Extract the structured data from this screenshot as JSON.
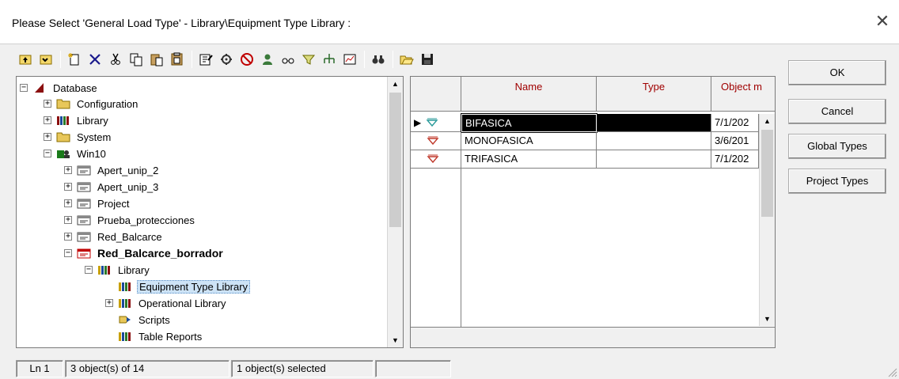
{
  "window": {
    "title": "Please Select 'General Load Type' - Library\\Equipment Type Library :",
    "close_icon": "close-icon"
  },
  "toolbar": {
    "icons": [
      "up-level-icon",
      "up-folder-icon",
      "new-object-icon",
      "delete-icon",
      "cut-icon",
      "copy-icon",
      "paste-icon",
      "paste-special-icon",
      "edit-object-icon",
      "tools-icon",
      "no-entry-icon",
      "user-icon",
      "glasses-icon",
      "filter-icon",
      "network-icon",
      "chart-icon",
      "find-icon",
      "open-folder-icon",
      "save-icon"
    ]
  },
  "tree": {
    "items": [
      {
        "label": "Database",
        "expander": "−",
        "icon": "database-icon"
      },
      {
        "label": "Configuration",
        "expander": "+",
        "icon": "folder-icon"
      },
      {
        "label": "Library",
        "expander": "+",
        "icon": "library-icon"
      },
      {
        "label": "System",
        "expander": "+",
        "icon": "folder-icon"
      },
      {
        "label": "Win10",
        "expander": "−",
        "icon": "user-folder-icon"
      },
      {
        "label": "Apert_unip_2",
        "expander": "+",
        "icon": "project-icon"
      },
      {
        "label": "Apert_unip_3",
        "expander": "+",
        "icon": "project-icon"
      },
      {
        "label": "Project",
        "expander": "+",
        "icon": "project-icon"
      },
      {
        "label": "Prueba_protecciones",
        "expander": "+",
        "icon": "project-icon"
      },
      {
        "label": "Red_Balcarce",
        "expander": "+",
        "icon": "project-icon"
      },
      {
        "label": "Red_Balcarce_borrador",
        "expander": "−",
        "icon": "active-project-icon"
      },
      {
        "label": "Library",
        "expander": "−",
        "icon": "library-icon"
      },
      {
        "label": "Equipment Type Library",
        "expander": "",
        "icon": "library-icon"
      },
      {
        "label": "Operational Library",
        "expander": "+",
        "icon": "library-icon"
      },
      {
        "label": "Scripts",
        "expander": "",
        "icon": "script-icon"
      },
      {
        "label": "Table Reports",
        "expander": "",
        "icon": "library-icon"
      }
    ]
  },
  "grid": {
    "columns": [
      "Name",
      "Type",
      "Object m"
    ],
    "rows": [
      {
        "name": "BIFASICA",
        "type": "",
        "modified": "7/1/202"
      },
      {
        "name": "MONOFASICA",
        "type": "",
        "modified": "3/6/201"
      },
      {
        "name": "TRIFASICA",
        "type": "",
        "modified": "7/1/202"
      }
    ]
  },
  "buttons": {
    "ok": "OK",
    "cancel": "Cancel",
    "global_types": "Global Types",
    "project_types": "Project Types"
  },
  "status": {
    "line": "Ln 1",
    "count": "3 object(s) of 14",
    "selected": "1 object(s) selected",
    "extra": ""
  },
  "colors": {
    "header_text": "#a00000",
    "load_icon": "#c0392b",
    "database_icon": "#8b1010",
    "folder": "#e8c75a"
  }
}
